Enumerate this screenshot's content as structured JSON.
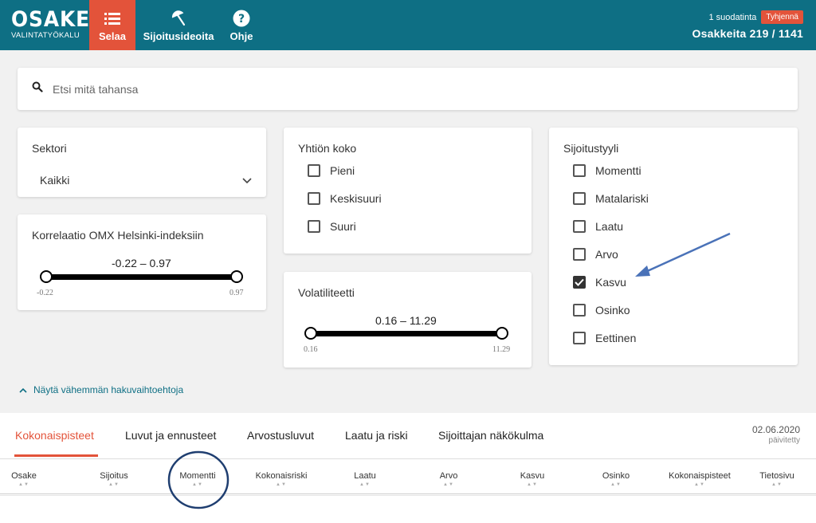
{
  "header": {
    "logo_main": "OSAKE",
    "logo_sub": "VALINTATYÖKALU",
    "nav": [
      {
        "label": "Selaa",
        "icon": "list-icon"
      },
      {
        "label": "Sijoitusideoita",
        "icon": "umbrella-icon"
      },
      {
        "label": "Ohje",
        "icon": "help-icon"
      }
    ],
    "filter_count": "1 suodatinta",
    "clear_label": "Tyhjennä",
    "stock_count": "Osakkeita 219 / 1141"
  },
  "search": {
    "placeholder": "Etsi mitä tahansa"
  },
  "sektori": {
    "title": "Sektori",
    "selected": "Kaikki"
  },
  "korrelaatio": {
    "title": "Korrelaatio OMX Helsinki-indeksiin",
    "range_text": "-0.22 – 0.97",
    "min": "-0.22",
    "max": "0.97"
  },
  "yhtion_koko": {
    "title": "Yhtiön koko",
    "options": [
      {
        "label": "Pieni",
        "checked": false
      },
      {
        "label": "Keskisuuri",
        "checked": false
      },
      {
        "label": "Suuri",
        "checked": false
      }
    ]
  },
  "volatiliteetti": {
    "title": "Volatiliteetti",
    "range_text": "0.16 – 11.29",
    "min": "0.16",
    "max": "11.29"
  },
  "sijoitustyyli": {
    "title": "Sijoitustyyli",
    "options": [
      {
        "label": "Momentti",
        "checked": false
      },
      {
        "label": "Matalariski",
        "checked": false
      },
      {
        "label": "Laatu",
        "checked": false
      },
      {
        "label": "Arvo",
        "checked": false
      },
      {
        "label": "Kasvu",
        "checked": true
      },
      {
        "label": "Osinko",
        "checked": false
      },
      {
        "label": "Eettinen",
        "checked": false
      }
    ]
  },
  "show_less": "Näytä vähemmän hakuvaihtoehtoja",
  "tabs": [
    {
      "label": "Kokonaispisteet",
      "active": true
    },
    {
      "label": "Luvut ja ennusteet",
      "active": false
    },
    {
      "label": "Arvostusluvut",
      "active": false
    },
    {
      "label": "Laatu ja riski",
      "active": false
    },
    {
      "label": "Sijoittajan näkökulma",
      "active": false
    }
  ],
  "updated": {
    "date": "02.06.2020",
    "label": "päivitetty"
  },
  "columns": [
    "Osake",
    "Sijoitus",
    "Momentti",
    "Kokonaisriski",
    "Laatu",
    "Arvo",
    "Kasvu",
    "Osinko",
    "Kokonaispisteet",
    "Tietosivu"
  ],
  "colors": {
    "header": "#0e6f84",
    "accent": "#e3533a",
    "annotation_arrow": "#4a72b8",
    "annotation_circle": "#1f3e70"
  }
}
